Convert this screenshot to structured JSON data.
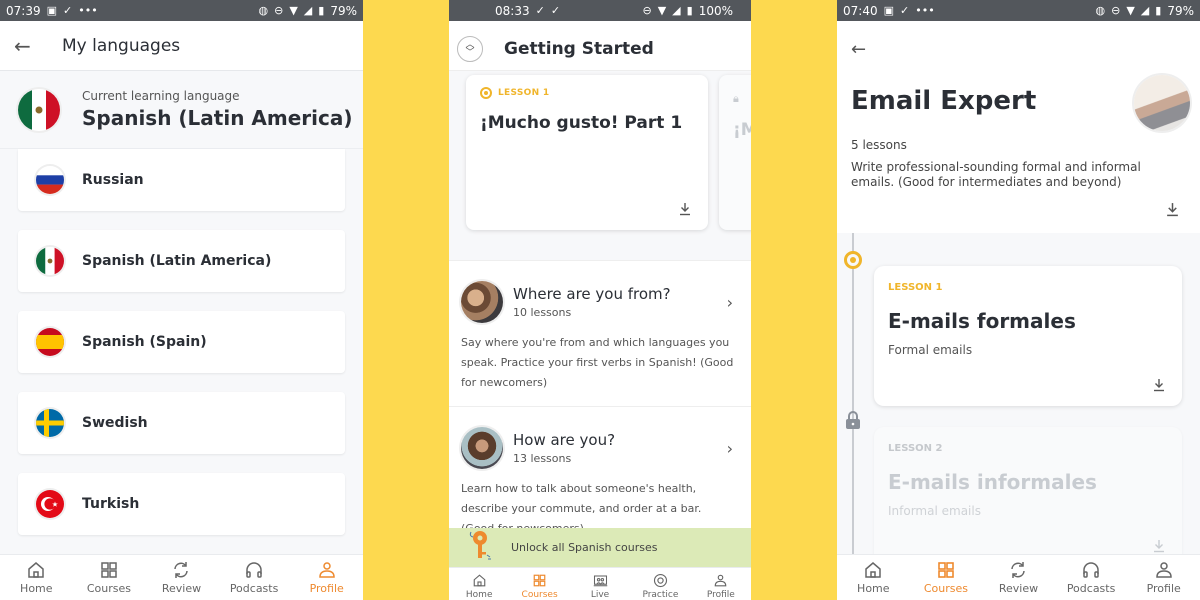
{
  "colors": {
    "accent": "#ee8a2f",
    "lesson_yellow": "#f0b52b",
    "background": "#fdd94f",
    "unlock_bar": "#dceab7"
  },
  "screen1": {
    "status": {
      "time": "07:39",
      "battery": "79%"
    },
    "header": {
      "title": "My languages",
      "back_icon": "arrow-left-icon"
    },
    "current": {
      "label": "Current learning language",
      "value": "Spanish (Latin America)",
      "flag": "mexico"
    },
    "languages": [
      {
        "name": "Russian",
        "flag": "russia"
      },
      {
        "name": "Spanish (Latin America)",
        "flag": "mexico"
      },
      {
        "name": "Spanish (Spain)",
        "flag": "spain"
      },
      {
        "name": "Swedish",
        "flag": "sweden"
      },
      {
        "name": "Turkish",
        "flag": "turkey"
      }
    ],
    "nav": [
      {
        "label": "Home",
        "icon": "home-icon",
        "active": false
      },
      {
        "label": "Courses",
        "icon": "grid-icon",
        "active": false
      },
      {
        "label": "Review",
        "icon": "refresh-icon",
        "active": false
      },
      {
        "label": "Podcasts",
        "icon": "headphones-icon",
        "active": false
      },
      {
        "label": "Profile",
        "icon": "person-icon",
        "active": true
      }
    ]
  },
  "screen2": {
    "status": {
      "time": "08:33",
      "battery": "100%"
    },
    "header": {
      "title": "Getting Started"
    },
    "lessons": [
      {
        "tag": "LESSON 1",
        "title": "¡Mucho gusto! Part 1",
        "locked": false
      },
      {
        "tag": "",
        "title": "¡M",
        "locked": true
      }
    ],
    "courses": [
      {
        "title": "Where are you from?",
        "count": "10 lessons",
        "description": "Say where you're from and which languages you speak. Practice your first verbs in Spanish! (Good for newcomers)"
      },
      {
        "title": "How are you?",
        "count": "13 lessons",
        "description": "Learn how to talk about someone's health, describe your commute, and order at a bar. (Good for newcomers)"
      }
    ],
    "unlock": {
      "label": "Unlock all Spanish courses"
    },
    "nav": [
      {
        "label": "Home",
        "icon": "home-icon",
        "active": false
      },
      {
        "label": "Courses",
        "icon": "grid-icon",
        "active": true
      },
      {
        "label": "Live",
        "icon": "live-class-icon",
        "active": false
      },
      {
        "label": "Practice",
        "icon": "target-icon",
        "active": false
      },
      {
        "label": "Profile",
        "icon": "person-icon",
        "active": false
      }
    ]
  },
  "screen3": {
    "status": {
      "time": "07:40",
      "battery": "79%"
    },
    "title": "Email Expert",
    "count": "5 lessons",
    "description": "Write professional-sounding formal and informal emails. (Good for intermediates and beyond)",
    "lessons": [
      {
        "tag": "LESSON 1",
        "title": "E-mails formales",
        "subtitle": "Formal emails",
        "locked": false
      },
      {
        "tag": "LESSON 2",
        "title": "E-mails informales",
        "subtitle": "Informal emails",
        "locked": true
      }
    ],
    "nav": [
      {
        "label": "Home",
        "icon": "home-icon",
        "active": false
      },
      {
        "label": "Courses",
        "icon": "grid-icon",
        "active": true
      },
      {
        "label": "Review",
        "icon": "refresh-icon",
        "active": false
      },
      {
        "label": "Podcasts",
        "icon": "headphones-icon",
        "active": false
      },
      {
        "label": "Profile",
        "icon": "person-icon",
        "active": false
      }
    ]
  }
}
